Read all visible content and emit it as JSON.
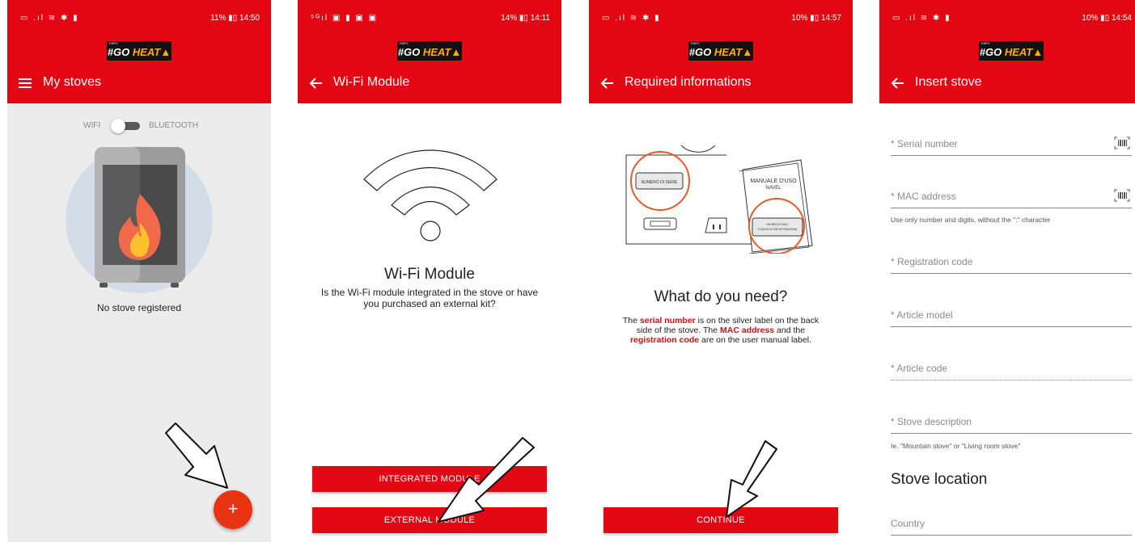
{
  "screens": [
    {
      "status": {
        "icons": "▭ .ıl ≋ ✱ ▮",
        "battery": "11%",
        "time": "14:50"
      },
      "logo": {
        "sub": "FAFO",
        "text_a": "#GO ",
        "text_b": "HEAT"
      },
      "title": "My stoves",
      "nav_icon": "menu-icon",
      "toggle": {
        "left": "WIFI",
        "right": "BLUETOOTH"
      },
      "empty_text": "No stove registered",
      "fab_label": "+"
    },
    {
      "status": {
        "icons": "⁵ᴳıl ▣ ▮ ▣ ▣",
        "battery": "14%",
        "time": "14:11"
      },
      "logo": {
        "sub": "FAFO",
        "text_a": "#GO ",
        "text_b": "HEAT"
      },
      "title": "Wi-Fi Module",
      "nav_icon": "back-arrow-icon",
      "heading": "Wi-Fi Module",
      "description": "Is the Wi-Fi module integrated in the stove or have you purchased an external kit?",
      "buttons": [
        "INTEGRATED MODULE",
        "EXTERNAL MODULE"
      ]
    },
    {
      "status": {
        "icons": "▭ .ıl ≋ ✱ ▮",
        "battery": "10%",
        "time": "14:57"
      },
      "logo": {
        "sub": "FAFO",
        "text_a": "#GO ",
        "text_b": "HEAT"
      },
      "title": "Required informations",
      "nav_icon": "back-arrow-icon",
      "illustration": {
        "serial_label": "NUMERO DI SERIE",
        "manual_title": "MANUALE D'USO",
        "manual_sub": "NAVEL",
        "manual_label_a": "INDIRIZZO MAC",
        "manual_label_b": "CODICE DI REGISTRAZIONE"
      },
      "heading": "What do you need?",
      "desc": {
        "p1": "The ",
        "h1": "serial number",
        "p2": " is on the silver label on the back side of the stove. The ",
        "h2": "MAC address",
        "p3": " and the ",
        "h3": "registration code",
        "p4": " are on the user manual label."
      },
      "button": "CONTINUE"
    },
    {
      "status": {
        "icons": "▭ .ıl ≋ ✱ ▮",
        "battery": "10%",
        "time": "14:54"
      },
      "logo": {
        "sub": "FAFO",
        "text_a": "#GO ",
        "text_b": "HEAT"
      },
      "title": "Insert stove",
      "nav_icon": "back-arrow-icon",
      "fields": {
        "serial": "* Serial number",
        "mac": "* MAC address",
        "registration": "* Registration code",
        "model": "* Article model",
        "code": "* Article code",
        "description": "* Stove description",
        "country": "Country"
      },
      "hints": {
        "mac": "Use only number and digits, without the \":\" character",
        "description": "Ie. \"Mountain stove\" or \"Living room stove\""
      },
      "section_title": "Stove location"
    }
  ],
  "colors": {
    "brand_red": "#e30613",
    "fab": "#e83412",
    "highlight": "#e30613"
  }
}
